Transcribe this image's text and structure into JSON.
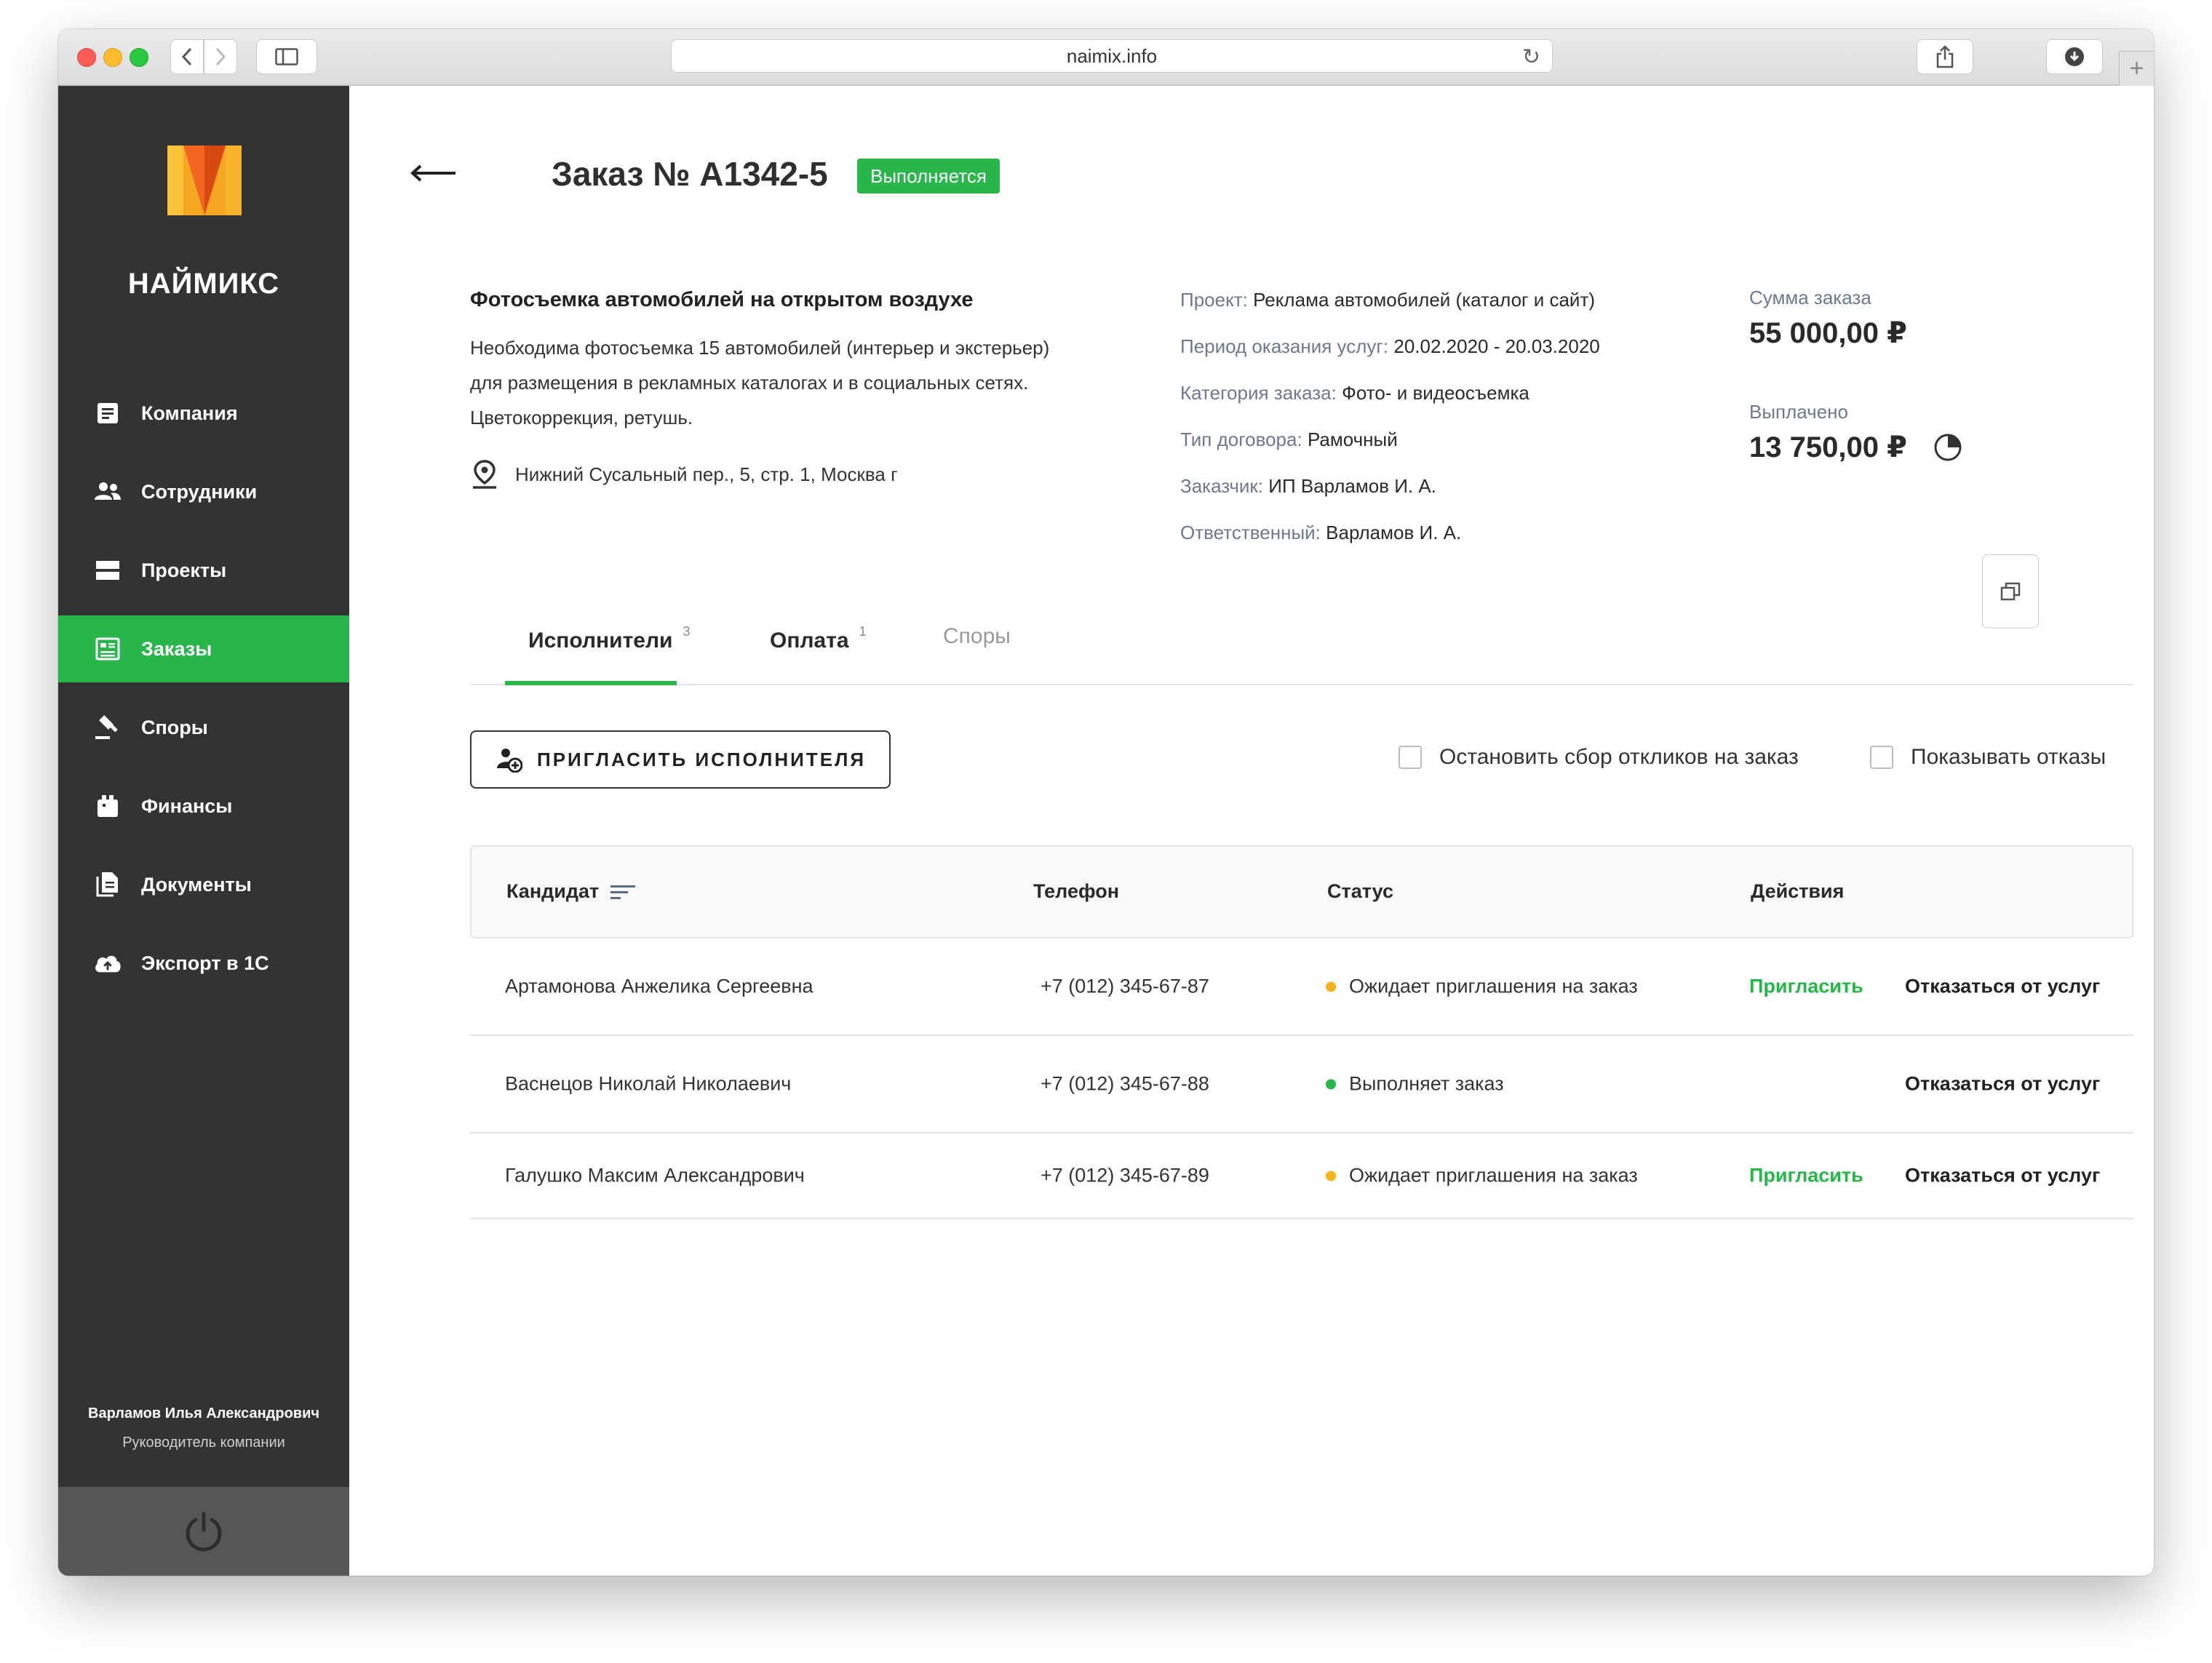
{
  "browser": {
    "url": "naimix.info"
  },
  "sidebar": {
    "brand": "НАЙМИКС",
    "items": [
      {
        "label": "Компания",
        "icon": "document-icon",
        "active": false
      },
      {
        "label": "Сотрудники",
        "icon": "people-icon",
        "active": false
      },
      {
        "label": "Проекты",
        "icon": "projects-icon",
        "active": false
      },
      {
        "label": "Заказы",
        "icon": "orders-icon",
        "active": true
      },
      {
        "label": "Споры",
        "icon": "gavel-icon",
        "active": false
      },
      {
        "label": "Финансы",
        "icon": "wallet-icon",
        "active": false
      },
      {
        "label": "Документы",
        "icon": "documents-icon",
        "active": false
      },
      {
        "label": "Экспорт в 1С",
        "icon": "cloud-upload-icon",
        "active": false
      }
    ],
    "user": {
      "name": "Варламов Илья Александрович",
      "role": "Руководитель компании"
    }
  },
  "order": {
    "title": "Заказ № А1342-5",
    "status_badge": "Выполняется",
    "name": "Фотосъемка автомобилей на открытом воздухе",
    "description_lines": [
      "Необходима фотосъемка 15 автомобилей (интерьер и экстерьер)",
      "для размещения в рекламных каталогах и в социальных сетях.",
      "Цветокоррекция, ретушь."
    ],
    "address": "Нижний Сусальный пер., 5, стр. 1, Москва г",
    "meta": [
      {
        "label": "Проект:",
        "value": "Реклама автомобилей (каталог и сайт)"
      },
      {
        "label": "Период оказания услуг:",
        "value": "20.02.2020 - 20.03.2020"
      },
      {
        "label": "Категория заказа:",
        "value": "Фото- и видеосъемка"
      },
      {
        "label": "Тип договора:",
        "value": "Рамочный"
      },
      {
        "label": "Заказчик:",
        "value": "ИП Варламов И. А."
      },
      {
        "label": "Ответственный:",
        "value": "Варламов И. А."
      }
    ],
    "amount_label": "Сумма заказа",
    "amount_value": "55 000,00 ₽",
    "paid_label": "Выплачено",
    "paid_value": "13 750,00 ₽",
    "paid_fraction": 0.25
  },
  "tabs": [
    {
      "label": "Исполнители",
      "count": "3",
      "active": true
    },
    {
      "label": "Оплата",
      "count": "1",
      "active": false
    },
    {
      "label": "Споры",
      "count": "",
      "active": false
    }
  ],
  "actions": {
    "invite_button": "ПРИГЛАСИТЬ ИСПОЛНИТЕЛЯ",
    "stop_responses": "Остановить сбор откликов на заказ",
    "show_refusals": "Показывать отказы"
  },
  "table": {
    "columns": [
      "Кандидат",
      "Телефон",
      "Статус",
      "Действия"
    ],
    "rows": [
      {
        "name": "Артамонова Анжелика Сергеевна",
        "phone": "+7 (012) 345-67-87",
        "status": "Ожидает приглашения на заказ",
        "status_color": "#f5b21b",
        "invite": "Пригласить",
        "refuse": "Отказаться от услуг"
      },
      {
        "name": "Васнецов Николай Николаевич",
        "phone": "+7 (012) 345-67-88",
        "status": "Выполняет заказ",
        "status_color": "#28b54a",
        "invite": "",
        "refuse": "Отказаться от услуг"
      },
      {
        "name": "Галушко Максим Александрович",
        "phone": "+7 (012) 345-67-89",
        "status": "Ожидает приглашения на заказ",
        "status_color": "#f5b21b",
        "invite": "Пригласить",
        "refuse": "Отказаться от услуг"
      }
    ]
  },
  "colors": {
    "accent": "#28b54a",
    "sidebar_bg": "#333333",
    "pending": "#f5b21b"
  }
}
